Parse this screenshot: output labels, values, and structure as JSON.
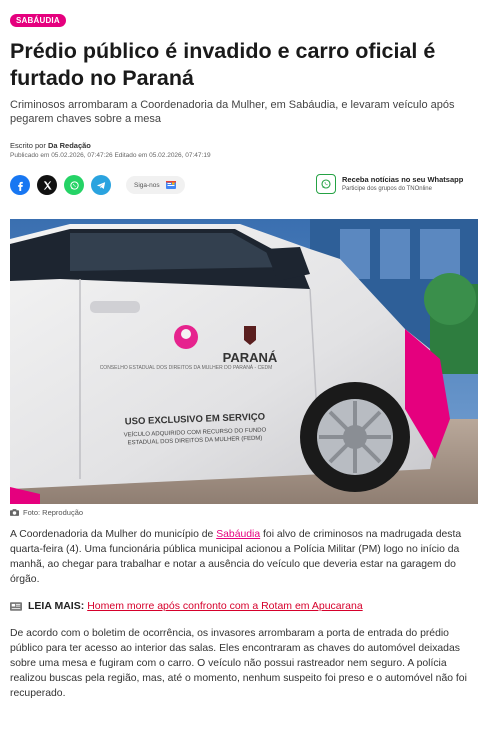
{
  "article": {
    "category": "SABÁUDIA",
    "title": "Prédio público é invadido e carro oficial é furtado no Paraná",
    "subtitle": "Criminosos arrombaram a Coordenadoria da Mulher, em Sabáudia, e levaram veículo após pegarem chaves sobre a mesa",
    "author_prefix": "Escrito por",
    "author": "Da Redação",
    "dates": "Publicado em 05.02.2026, 07:47:26 Editado em 05.02.2026, 07:47:19"
  },
  "share": {
    "follow_label": "Siga-nos",
    "whatsapp_title": "Receba notícias no seu Whatsapp",
    "whatsapp_sub": "Participe dos grupos do TNOnline",
    "icons": [
      "facebook-icon",
      "x-icon",
      "whatsapp-icon",
      "telegram-icon",
      "google-news-icon"
    ]
  },
  "photo": {
    "caption": "Foto: Reprodução",
    "car_text_parana": "PARANÁ",
    "car_text_uso": "USO EXCLUSIVO EM SERVIÇO",
    "car_text_veiculo": "VEÍCULO ADQUIRIDO COM RECURSO DO FUNDO",
    "car_text_estadual": "ESTADUAL DOS DIREITOS DA MULHER (FEDM)",
    "car_text_conselho": "CONSELHO ESTADUAL DOS DIREITOS DA MULHER DO PARANÁ - CEDM"
  },
  "body": {
    "p1_a": "A Coordenadoria da Mulher do município de ",
    "p1_link": "Sabáudia",
    "p1_b": " foi alvo de criminosos na madrugada desta quarta-feira (4). Uma funcionária pública municipal acionou a Polícia Militar (PM) logo no início da manhã, ao chegar para trabalhar e notar a ausência do veículo que deveria estar na garagem do órgão.",
    "leia_label": "LEIA MAIS:",
    "leia_link": " Homem morre após confronto com a Rotam em Apucarana",
    "p2": "De acordo com o boletim de ocorrência, os invasores arrombaram a porta de entrada do prédio público para ter acesso ao interior das salas. Eles encontraram as chaves do automóvel deixadas sobre uma mesa e fugiram com o carro. O veículo não possui rastreador nem seguro. A polícia realizou buscas pela região, mas, até o momento, nenhum suspeito foi preso e o automóvel não foi recuperado."
  },
  "colors": {
    "accent": "#e5007e",
    "link_red": "#d6002b"
  }
}
